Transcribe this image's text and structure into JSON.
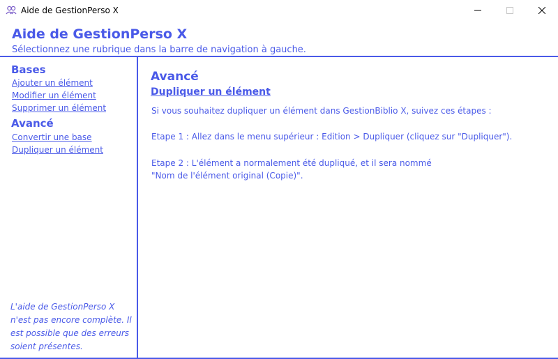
{
  "window": {
    "title": "Aide de GestionPerso X"
  },
  "header": {
    "title": "Aide de GestionPerso X",
    "subtitle": "Sélectionnez une rubrique dans la barre de navigation à gauche."
  },
  "sidebar": {
    "sections": [
      {
        "title": "Bases",
        "items": [
          "Ajouter un élément",
          "Modifier un élément",
          "Supprimer un élément"
        ]
      },
      {
        "title": "Avancé",
        "items": [
          "Convertir une base",
          "Dupliquer un élément"
        ]
      }
    ],
    "note": "L'aide de GestionPerso X n'est pas encore complète. Il est possible que des erreurs soient présentes."
  },
  "content": {
    "title": "Avancé",
    "subtitle": "Dupliquer un élément",
    "intro": "Si vous souhaitez dupliquer un élément dans GestionBiblio X, suivez ces étapes :",
    "step1": "Etape 1 : Allez dans le menu supérieur : Edition > Dupliquer (cliquez sur \"Dupliquer\").",
    "step2_line1": "Etape 2 : L'élément a normalement été dupliqué, et il sera nommé",
    "step2_line2": "\"Nom de l'élément original (Copie)\"."
  },
  "colors": {
    "accent": "#4a5ae8",
    "background": "#ffffff"
  }
}
